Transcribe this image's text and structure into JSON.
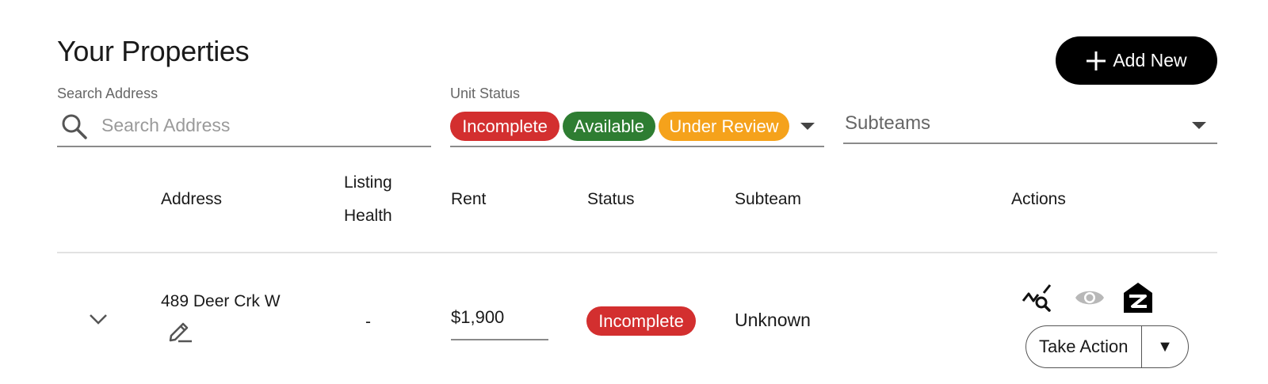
{
  "page": {
    "title": "Your Properties"
  },
  "toolbar": {
    "add_new_label": "Add New"
  },
  "filters": {
    "search": {
      "label": "Search Address",
      "placeholder": "Search Address",
      "value": ""
    },
    "unit_status": {
      "label": "Unit Status",
      "chips": [
        {
          "label": "Incomplete",
          "color": "#d32f2f"
        },
        {
          "label": "Available",
          "color": "#2e7d32"
        },
        {
          "label": "Under Review",
          "color": "#f5a21b"
        }
      ]
    },
    "subteams": {
      "placeholder": "Subteams"
    }
  },
  "table": {
    "headers": {
      "address": "Address",
      "listing_health_line1": "Listing",
      "listing_health_line2": "Health",
      "rent": "Rent",
      "status": "Status",
      "subteam": "Subteam",
      "actions": "Actions"
    },
    "rows": [
      {
        "address": "489 Deer Crk W",
        "listing_health": "-",
        "rent": "$1,900",
        "status": "Incomplete",
        "status_color": "#d32f2f",
        "subteam": "Unknown",
        "action_icons": [
          "market-analysis-icon",
          "preview-eye-icon",
          "zillow-icon"
        ],
        "take_action_label": "Take Action",
        "take_action_arrow": "▼"
      }
    ]
  }
}
